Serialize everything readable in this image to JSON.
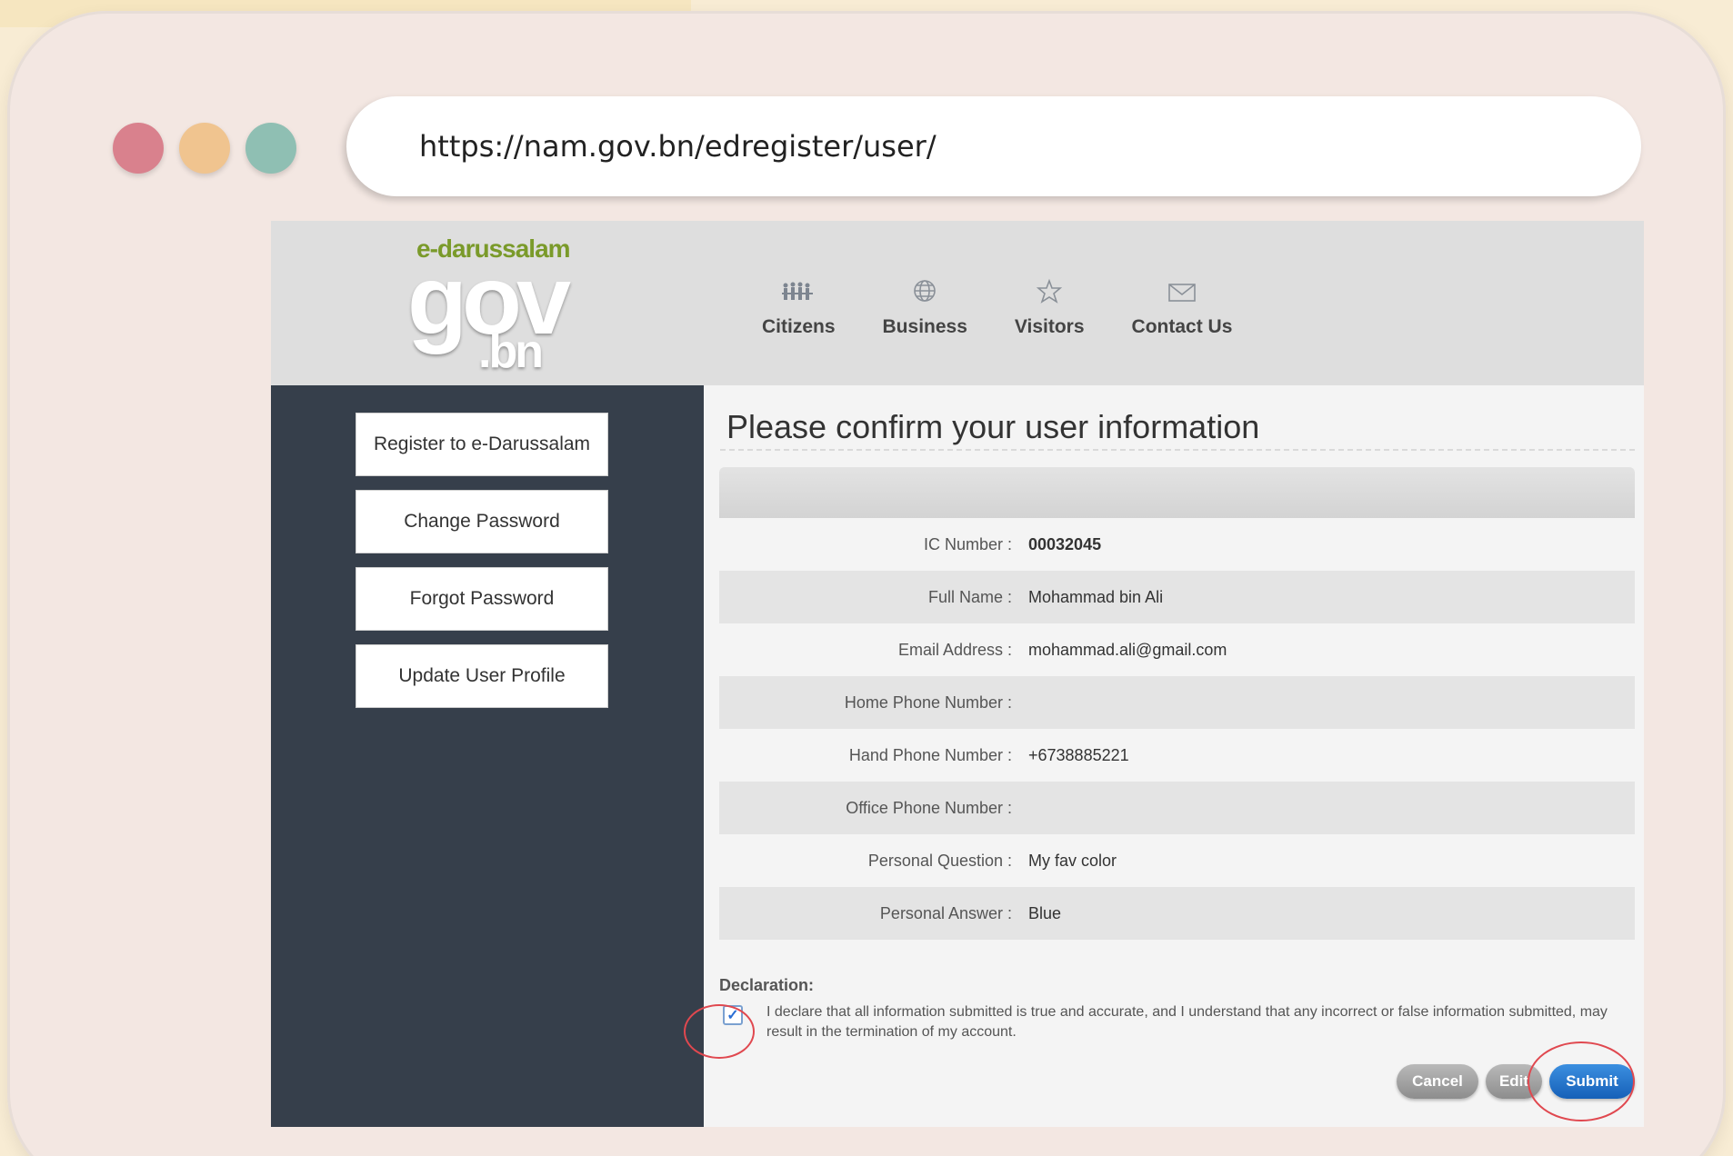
{
  "browser": {
    "url": "https://nam.gov.bn/edregister/user/"
  },
  "header": {
    "logo": {
      "top": "e-darussalam",
      "main": "gov",
      "suffix": ".bn"
    },
    "nav": [
      {
        "label": "Citizens",
        "icon": "people-icon"
      },
      {
        "label": "Business",
        "icon": "globe-icon"
      },
      {
        "label": "Visitors",
        "icon": "star-icon"
      },
      {
        "label": "Contact Us",
        "icon": "mail-icon"
      }
    ]
  },
  "sidebar": {
    "items": [
      {
        "label": "Register to e-Darussalam"
      },
      {
        "label": "Change Password"
      },
      {
        "label": "Forgot Password"
      },
      {
        "label": "Update User Profile"
      }
    ]
  },
  "main": {
    "title": "Please confirm your user information",
    "fields": [
      {
        "label": "IC Number :",
        "value": "00032045"
      },
      {
        "label": "Full Name :",
        "value": "Mohammad bin Ali"
      },
      {
        "label": "Email Address :",
        "value": "mohammad.ali@gmail.com"
      },
      {
        "label": "Home Phone Number :",
        "value": ""
      },
      {
        "label": "Hand Phone Number :",
        "value": "+6738885221"
      },
      {
        "label": "Office Phone Number :",
        "value": ""
      },
      {
        "label": "Personal Question :",
        "value": "My fav color"
      },
      {
        "label": "Personal Answer :",
        "value": "Blue"
      }
    ],
    "declaration": {
      "title": "Declaration:",
      "checkbox_checked": true,
      "text": "I declare that all information submitted is true and accurate, and I understand that any incorrect or false information submitted, may result in the termination of my account."
    },
    "buttons": {
      "cancel": "Cancel",
      "edit": "Edit",
      "submit": "Submit"
    }
  },
  "colors": {
    "sidebar_bg": "#363f4b",
    "submit": "#1a6cc4",
    "highlight": "#e0484f",
    "logo_green": "#7a9a2a"
  }
}
